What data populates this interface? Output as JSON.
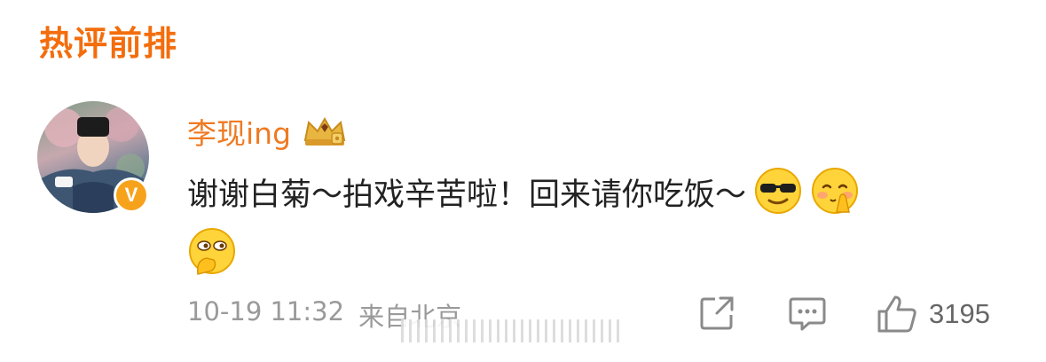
{
  "section": {
    "title": "热评前排"
  },
  "comment": {
    "username": "李现ing",
    "text_line": "谢谢白菊～拍戏辛苦啦！回来请你吃饭～",
    "emojis": [
      "cool-sunglasses-emoji",
      "prayer-blush-emoji",
      "thinking-hand-emoji"
    ],
    "date": "10-19 11:32",
    "location": "来自北京",
    "likes": "3195"
  },
  "colors": {
    "accent": "#f36d0d",
    "username": "#ee7a22",
    "text": "#222222",
    "meta": "#9a9a9a"
  },
  "icons": {
    "share": "share-icon",
    "comment": "comment-icon",
    "like": "like-icon",
    "verified": "verified-v-badge",
    "crown": "crown-badge-icon"
  }
}
